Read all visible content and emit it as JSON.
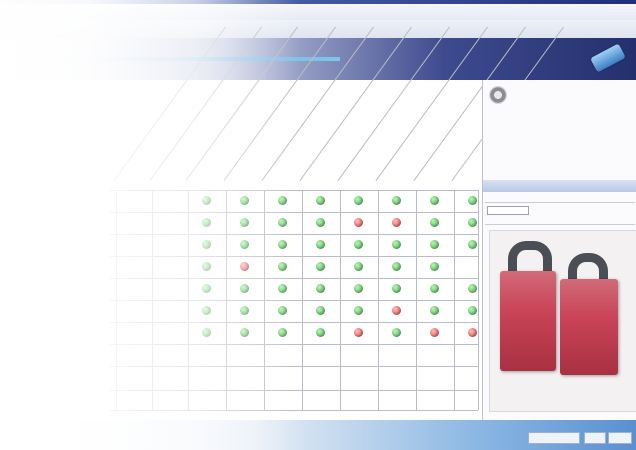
{
  "app": {
    "menu": [
      "",
      "",
      "",
      "",
      ""
    ],
    "right_menu": [
      "",
      "",
      ""
    ],
    "toolbar": [
      "",
      "",
      "",
      ""
    ]
  },
  "matrix": {
    "columns": [
      "",
      "",
      "",
      "",
      "",
      "",
      "",
      "",
      "",
      ""
    ],
    "rows": 8,
    "colors": {
      "green": "#3fae49",
      "red": "#dd3b39"
    }
  },
  "panel": {
    "meta": [
      "",
      "",
      ""
    ]
  },
  "icons": [
    "logo-icon",
    "gear-icon",
    "padlock-icon"
  ]
}
